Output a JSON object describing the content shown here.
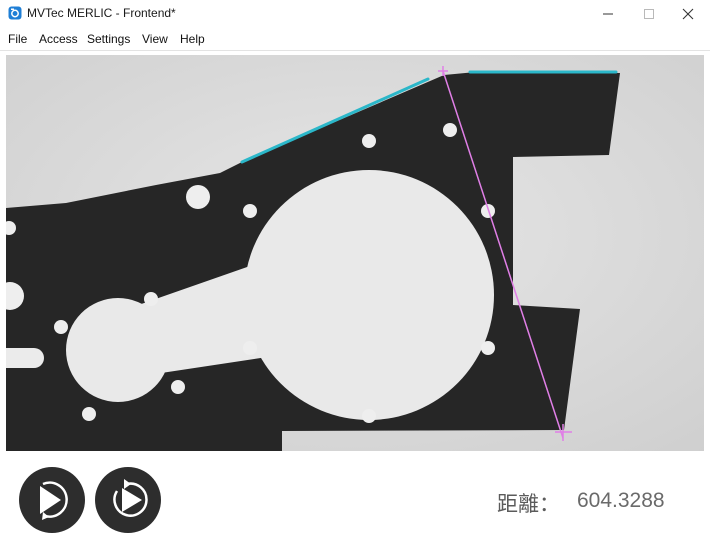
{
  "window": {
    "title": "MVTec MERLIC - Frontend*",
    "app_icon": "camera-icon",
    "controls": [
      "minimize-icon",
      "maximize-icon",
      "close-icon"
    ]
  },
  "menu": {
    "items": [
      {
        "label": "File"
      },
      {
        "label": "Access"
      },
      {
        "label": "Settings"
      },
      {
        "label": "View"
      },
      {
        "label": "Help"
      }
    ]
  },
  "viewer": {
    "edge_color": "#2bb7c9",
    "measure_line_color": "#e07fe6"
  },
  "controls": {
    "single_run_icon": "single-run-icon",
    "continuous_run_icon": "continuous-run-icon",
    "button_color": "#2d2d2d"
  },
  "result": {
    "label": "距離：",
    "value": "604.3288"
  }
}
